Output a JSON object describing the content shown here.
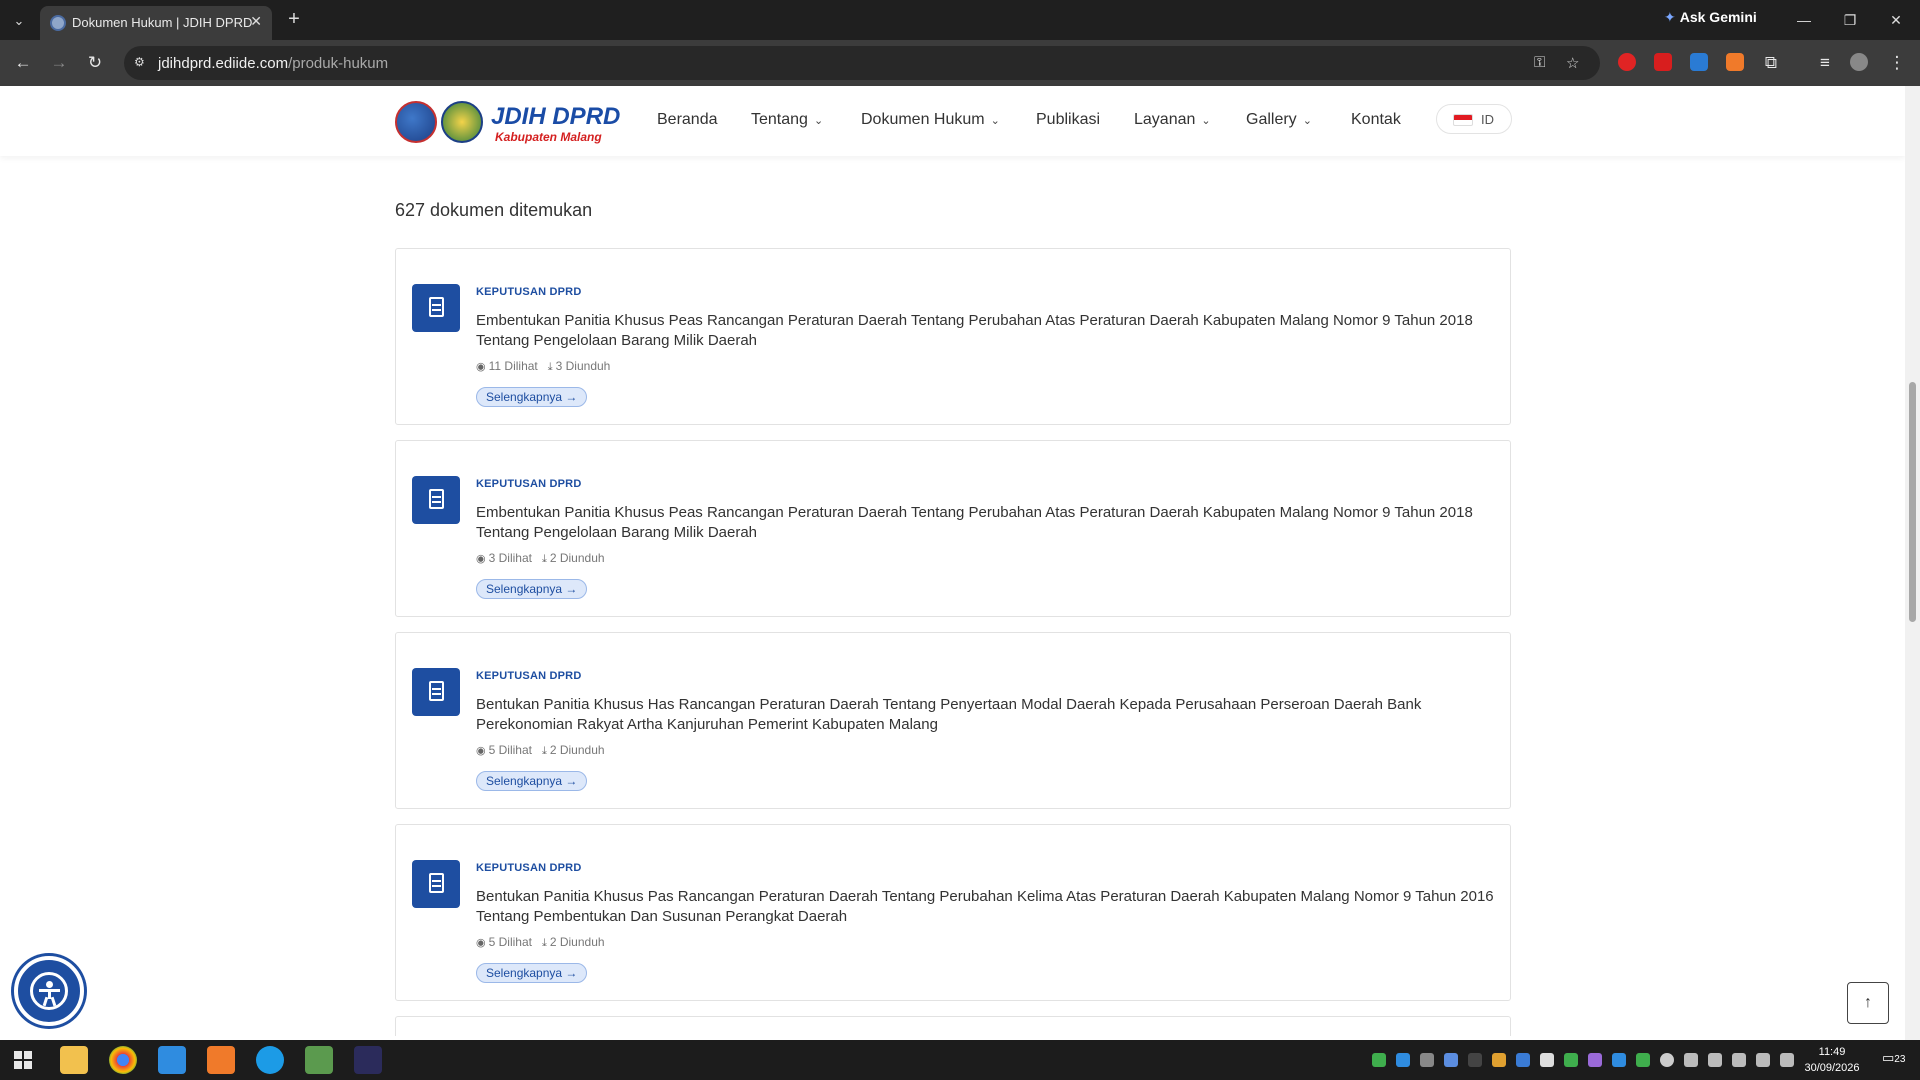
{
  "browser": {
    "tab_title": "Dokumen Hukum | JDIH DPRD",
    "url_host": "jdihdprd.ediide.com",
    "url_path": "/produk-hukum",
    "gemini_label": "Ask Gemini"
  },
  "site": {
    "logo_title": "JDIH DPRD",
    "logo_subtitle": "Kabupaten Malang",
    "menu": [
      {
        "label": "Beranda"
      },
      {
        "label": "Tentang"
      },
      {
        "label": "Dokumen Hukum"
      },
      {
        "label": "Publikasi"
      },
      {
        "label": "Layanan"
      },
      {
        "label": "Gallery"
      },
      {
        "label": "Kontak"
      }
    ],
    "language": "ID"
  },
  "results": {
    "count_text": "627 dokumen ditemukan",
    "more_label": "Selengkapnya →",
    "documents": [
      {
        "category": "KEPUTUSAN DPRD",
        "title": "Embentukan Panitia Khusus Peas Rancangan Peraturan Daerah Tentang Perubahan Atas Peraturan Daerah Kabupaten Malang Nomor 9 Tahun 2018 Tentang Pengelolaan Barang Milik Daerah",
        "views": "11 Dilihat",
        "downloads": "3 Diunduh"
      },
      {
        "category": "KEPUTUSAN DPRD",
        "title": "Embentukan Panitia Khusus Peas Rancangan Peraturan Daerah Tentang Perubahan Atas Peraturan Daerah Kabupaten Malang Nomor 9 Tahun 2018 Tentang Pengelolaan Barang Milik Daerah",
        "views": "3 Dilihat",
        "downloads": "2 Diunduh"
      },
      {
        "category": "KEPUTUSAN DPRD",
        "title": "Bentukan Panitia Khusus Has Rancangan Peraturan Daerah Tentang Penyertaan Modal Daerah Kepada Perusahaan Perseroan Daerah Bank Perekonomian Rakyat Artha Kanjuruhan Pemerint Kabupaten Malang",
        "views": "5 Dilihat",
        "downloads": "2 Diunduh"
      },
      {
        "category": "KEPUTUSAN DPRD",
        "title": "Bentukan Panitia Khusus Pas Rancangan Peraturan Daerah Tentang Perubahan Kelima Atas Peraturan Daerah Kabupaten Malang Nomor 9 Tahun 2016 Tentang Pembentukan Dan Susunan Perangkat Daerah",
        "views": "5 Dilihat",
        "downloads": "2 Diunduh"
      }
    ]
  },
  "taskbar": {
    "time": "11:49",
    "date": "30/09/2026",
    "notification_count": "23"
  },
  "colors": {
    "brand_blue": "#1e4ea1",
    "brand_red": "#d42020"
  },
  "icons": [
    "document-icon",
    "eye-icon",
    "download-icon",
    "accessibility-icon",
    "arrow-up-icon",
    "chevron-down-icon"
  ]
}
